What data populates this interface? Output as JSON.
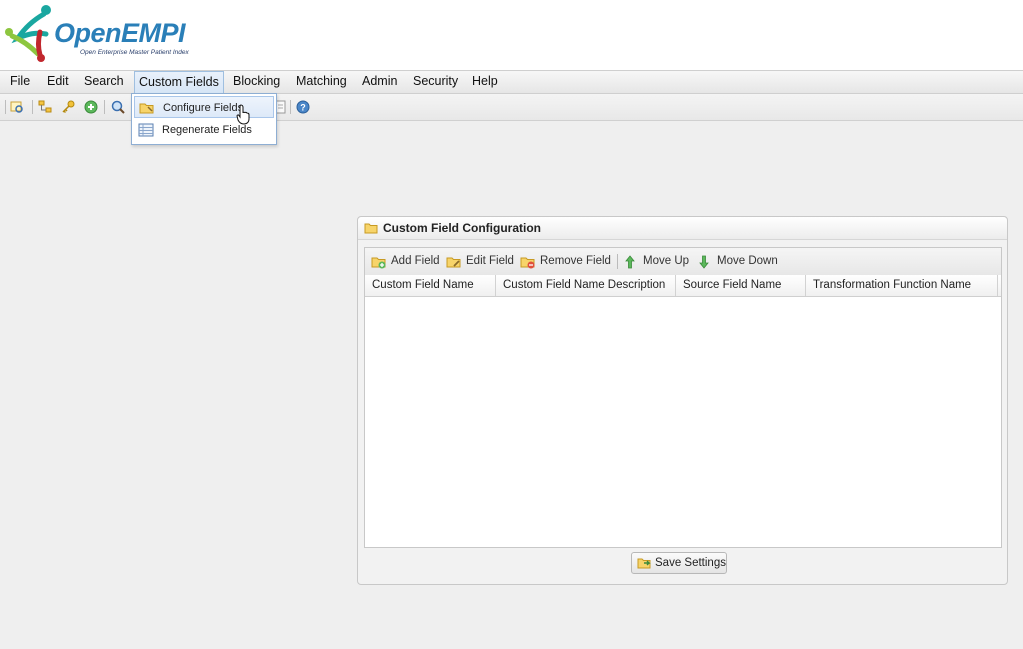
{
  "app": {
    "logo_text_open": "Open",
    "logo_text_empi": "EMPI",
    "logo_subtitle": "Open Enterprise Master Patient Index"
  },
  "menu": [
    "File",
    "Edit",
    "Search",
    "Custom Fields",
    "Blocking",
    "Matching",
    "Admin",
    "Security",
    "Help"
  ],
  "active_menu": "Custom Fields",
  "dropdown": {
    "items": [
      "Configure Fields",
      "Regenerate Fields"
    ],
    "hovered": "Configure Fields"
  },
  "toolbar": {
    "icons": [
      "search-form-icon",
      "hierarchy-icon",
      "key-icon",
      "add-icon",
      "magnifier-icon",
      "document-icon",
      "help-icon"
    ]
  },
  "panel": {
    "title": "Custom Field Configuration",
    "toolbar": [
      "Add Field",
      "Edit Field",
      "Remove Field",
      "Move Up",
      "Move Down"
    ],
    "columns": [
      "Custom Field Name",
      "Custom Field Name Description",
      "Source Field Name",
      "Transformation Function Name"
    ],
    "rows": [],
    "save_label": "Save Settings"
  },
  "colors": {
    "brand_blue": "#2a7fb8",
    "menu_highlight": "#d6e5f6",
    "move_up_green": "#3aa03a"
  }
}
